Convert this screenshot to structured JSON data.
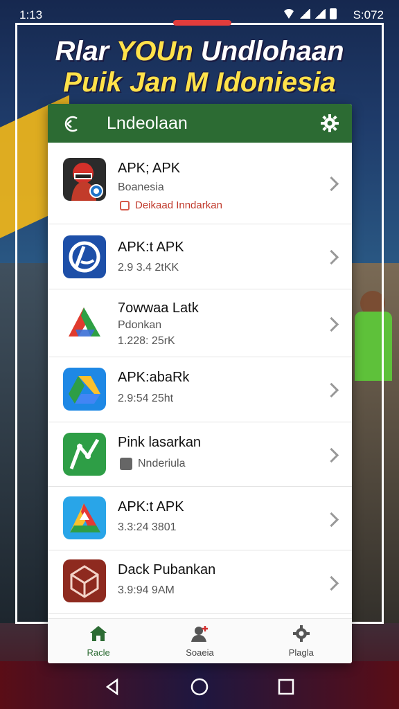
{
  "status_bar": {
    "time": "1:13",
    "right_text": "S:072"
  },
  "headline": {
    "line1_part1": "Rlar ",
    "line1_part2": "YOUn",
    "line1_part3": " Undlohaan",
    "line2": "Puik Jan M Idoniesia"
  },
  "app_bar": {
    "title": "Lndeolaan",
    "back_icon": "back-arrow-icon",
    "settings_icon": "gear-icon"
  },
  "apps": [
    {
      "title": "APK; APK",
      "sub": "Boanesia",
      "tag": "Deikaad Inndarkan",
      "icon": "racer-helmet-icon"
    },
    {
      "title": "APK:t APK",
      "sub": "2.9 3.4 2tKK",
      "icon": "blue-p-logo-icon"
    },
    {
      "title": "7owwaa Latk",
      "sub": "Pdonkan",
      "sub2": "1.228: 25rK",
      "icon": "green-red-a-logo-icon"
    },
    {
      "title": "APK:abaRk",
      "sub": "2.9:54 25ht",
      "icon": "drive-triangle-icon"
    },
    {
      "title": "Pink lasarkan",
      "tag_gray": "Nnderiula",
      "icon": "green-route-icon"
    },
    {
      "title": "APK:t APK",
      "sub": "3.3:24 3801",
      "icon": "colorful-a-logo-icon"
    },
    {
      "title": "Dack Pubankan",
      "sub": "3.9:94 9AM",
      "icon": "red-cube-icon"
    }
  ],
  "bottom_nav": [
    {
      "label": "Racle",
      "icon": "home-icon",
      "active": true
    },
    {
      "label": "Soaeia",
      "icon": "person-add-icon",
      "active": false
    },
    {
      "label": "Plagla",
      "icon": "gear-icon",
      "active": false
    }
  ],
  "colors": {
    "accent": "#2c6b33",
    "tag_red": "#c0392b",
    "headline_yellow": "#ffe24a"
  }
}
